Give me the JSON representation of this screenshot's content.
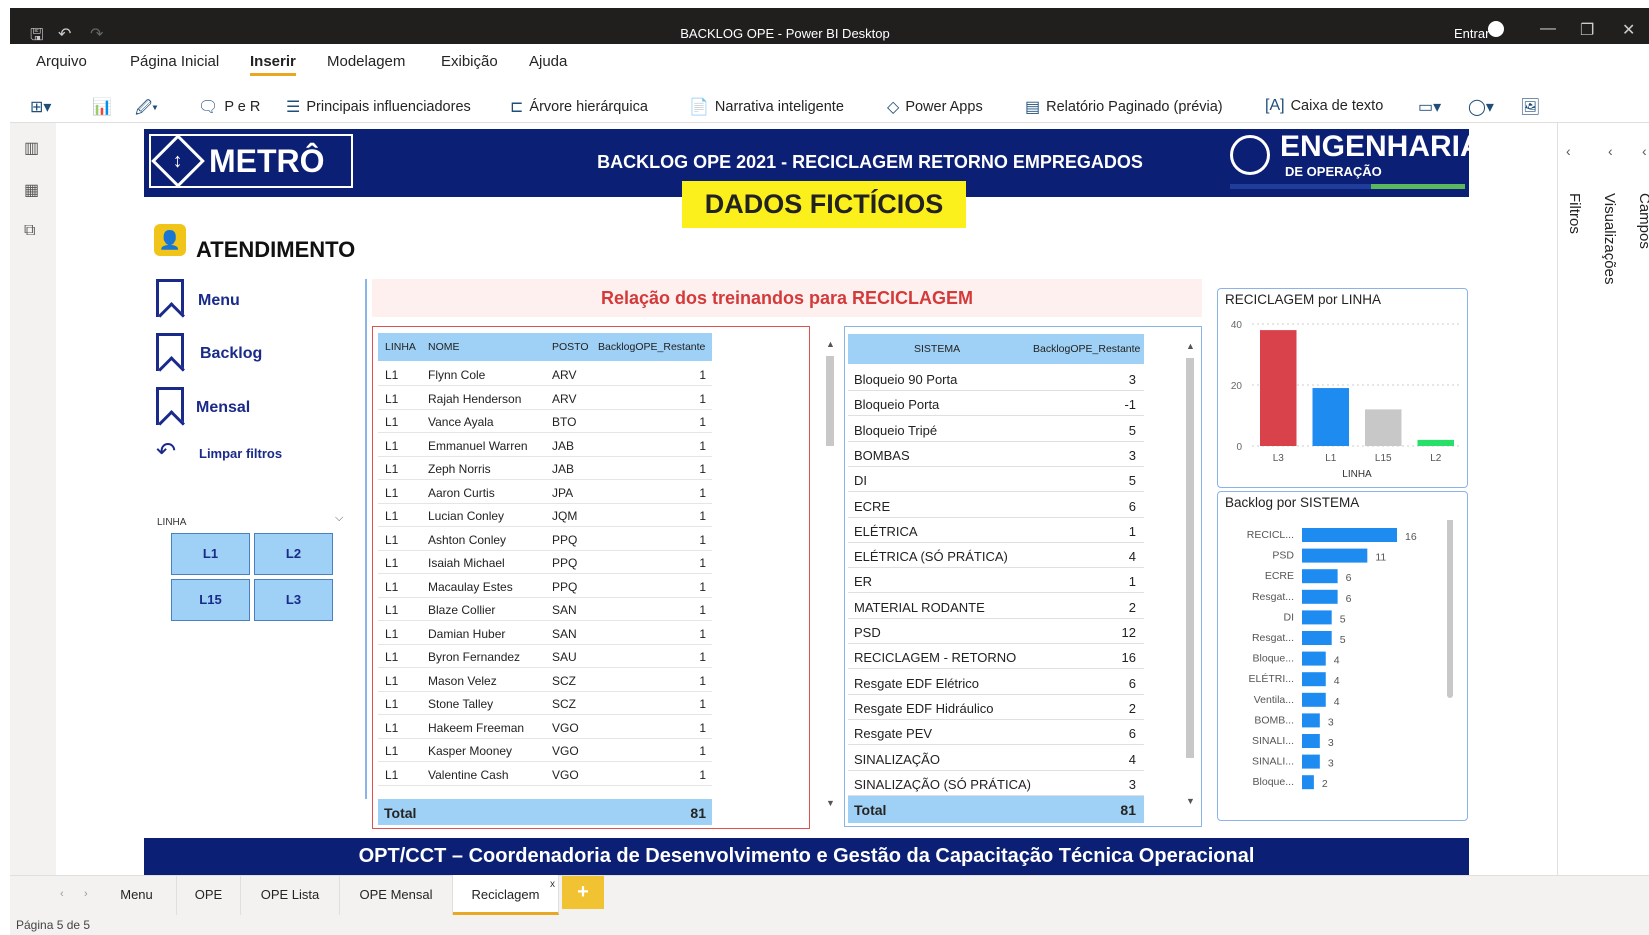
{
  "window": {
    "title": "BACKLOG OPE - Power BI Desktop",
    "signin": "Entrar"
  },
  "menu": {
    "items": [
      "Arquivo",
      "Página Inicial",
      "Inserir",
      "Modelagem",
      "Exibição",
      "Ajuda"
    ],
    "active": "Inserir"
  },
  "ribbon": {
    "per": "P e R",
    "influenciadores": "Principais influenciadores",
    "arvore": "Árvore hierárquica",
    "narrativa": "Narrativa inteligente",
    "powerapps": "Power Apps",
    "paginado": "Relatório Paginado (prévia)",
    "caixa": "Caixa de texto"
  },
  "report": {
    "metro": "METRÔ",
    "title": "BACKLOG OPE 2021 - RECICLAGEM RETORNO EMPREGADOS",
    "eng": "ENGENHARIA",
    "eng_sub": "DE OPERAÇÃO",
    "ficticios": "DADOS FICTÍCIOS",
    "atendimento": "ATENDIMENTO",
    "nav": {
      "menu": "Menu",
      "backlog": "Backlog",
      "mensal": "Mensal",
      "limpar": "Limpar filtros"
    },
    "slicer": {
      "label": "LINHA",
      "options": [
        "L1",
        "L2",
        "L15",
        "L3"
      ]
    },
    "relacao": "Relação dos treinandos para RECICLAGEM",
    "footer": "OPT/CCT – Coordenadoria de Desenvolvimento e Gestão da Capacitação Técnica Operacional"
  },
  "table1": {
    "headers": [
      "LINHA",
      "NOME",
      "POSTO",
      "BacklogOPE_Restante"
    ],
    "rows": [
      [
        "L1",
        "Flynn Cole",
        "ARV",
        "1"
      ],
      [
        "L1",
        "Rajah Henderson",
        "ARV",
        "1"
      ],
      [
        "L1",
        "Vance Ayala",
        "BTO",
        "1"
      ],
      [
        "L1",
        "Emmanuel Warren",
        "JAB",
        "1"
      ],
      [
        "L1",
        "Zeph Norris",
        "JAB",
        "1"
      ],
      [
        "L1",
        "Aaron Curtis",
        "JPA",
        "1"
      ],
      [
        "L1",
        "Lucian Conley",
        "JQM",
        "1"
      ],
      [
        "L1",
        "Ashton Conley",
        "PPQ",
        "1"
      ],
      [
        "L1",
        "Isaiah Michael",
        "PPQ",
        "1"
      ],
      [
        "L1",
        "Macaulay Estes",
        "PPQ",
        "1"
      ],
      [
        "L1",
        "Blaze Collier",
        "SAN",
        "1"
      ],
      [
        "L1",
        "Damian Huber",
        "SAN",
        "1"
      ],
      [
        "L1",
        "Byron Fernandez",
        "SAU",
        "1"
      ],
      [
        "L1",
        "Mason Velez",
        "SCZ",
        "1"
      ],
      [
        "L1",
        "Stone Talley",
        "SCZ",
        "1"
      ],
      [
        "L1",
        "Hakeem Freeman",
        "VGO",
        "1"
      ],
      [
        "L1",
        "Kasper Mooney",
        "VGO",
        "1"
      ],
      [
        "L1",
        "Valentine Cash",
        "VGO",
        "1"
      ]
    ],
    "total_label": "Total",
    "total": "81"
  },
  "table2": {
    "headers": [
      "SISTEMA",
      "BacklogOPE_Restante"
    ],
    "rows": [
      [
        "Bloqueio 90 Porta",
        "3"
      ],
      [
        "Bloqueio Porta",
        "-1"
      ],
      [
        "Bloqueio Tripé",
        "5"
      ],
      [
        "BOMBAS",
        "3"
      ],
      [
        "DI",
        "5"
      ],
      [
        "ECRE",
        "6"
      ],
      [
        "ELÉTRICA",
        "1"
      ],
      [
        "ELÉTRICA (SÓ PRÁTICA)",
        "4"
      ],
      [
        "ER",
        "1"
      ],
      [
        "MATERIAL RODANTE",
        "2"
      ],
      [
        "PSD",
        "12"
      ],
      [
        "RECICLAGEM - RETORNO",
        "16"
      ],
      [
        "Resgate EDF Elétrico",
        "6"
      ],
      [
        "Resgate EDF Hidráulico",
        "2"
      ],
      [
        "Resgate PEV",
        "6"
      ],
      [
        "SINALIZAÇÃO",
        "4"
      ],
      [
        "SINALIZAÇÃO (SÓ PRÁTICA)",
        "3"
      ]
    ],
    "total_label": "Total",
    "total": "81"
  },
  "chart_data": [
    {
      "type": "bar",
      "title": "RECICLAGEM por LINHA",
      "xlabel": "LINHA",
      "categories": [
        "L3",
        "L1",
        "L15",
        "L2"
      ],
      "values": [
        38,
        19,
        12,
        2
      ],
      "ylim": [
        0,
        40
      ],
      "yticks": [
        "40",
        "20",
        "0"
      ],
      "colors": [
        "#d9414b",
        "#1e8bf0",
        "#c8c8c8",
        "#27e06a"
      ]
    },
    {
      "type": "bar",
      "orientation": "horizontal",
      "title": "Backlog por SISTEMA",
      "categories": [
        "RECICL...",
        "PSD",
        "ECRE",
        "Resgat...",
        "DI",
        "Resgat...",
        "Bloque...",
        "ELÉTRI...",
        "Ventila...",
        "BOMB...",
        "SINALI...",
        "SINALI...",
        "Bloque..."
      ],
      "values": [
        16,
        11,
        6,
        6,
        5,
        5,
        4,
        4,
        4,
        3,
        3,
        3,
        2
      ],
      "color": "#1e8bf0"
    }
  ],
  "tabs": {
    "items": [
      "Menu",
      "OPE",
      "OPE Lista",
      "OPE Mensal",
      "Reciclagem"
    ],
    "active": "Reciclagem"
  },
  "panes": {
    "filtros": "Filtros",
    "visualizacoes": "Visualizações",
    "campos": "Campos"
  },
  "status": "Página 5 de 5"
}
